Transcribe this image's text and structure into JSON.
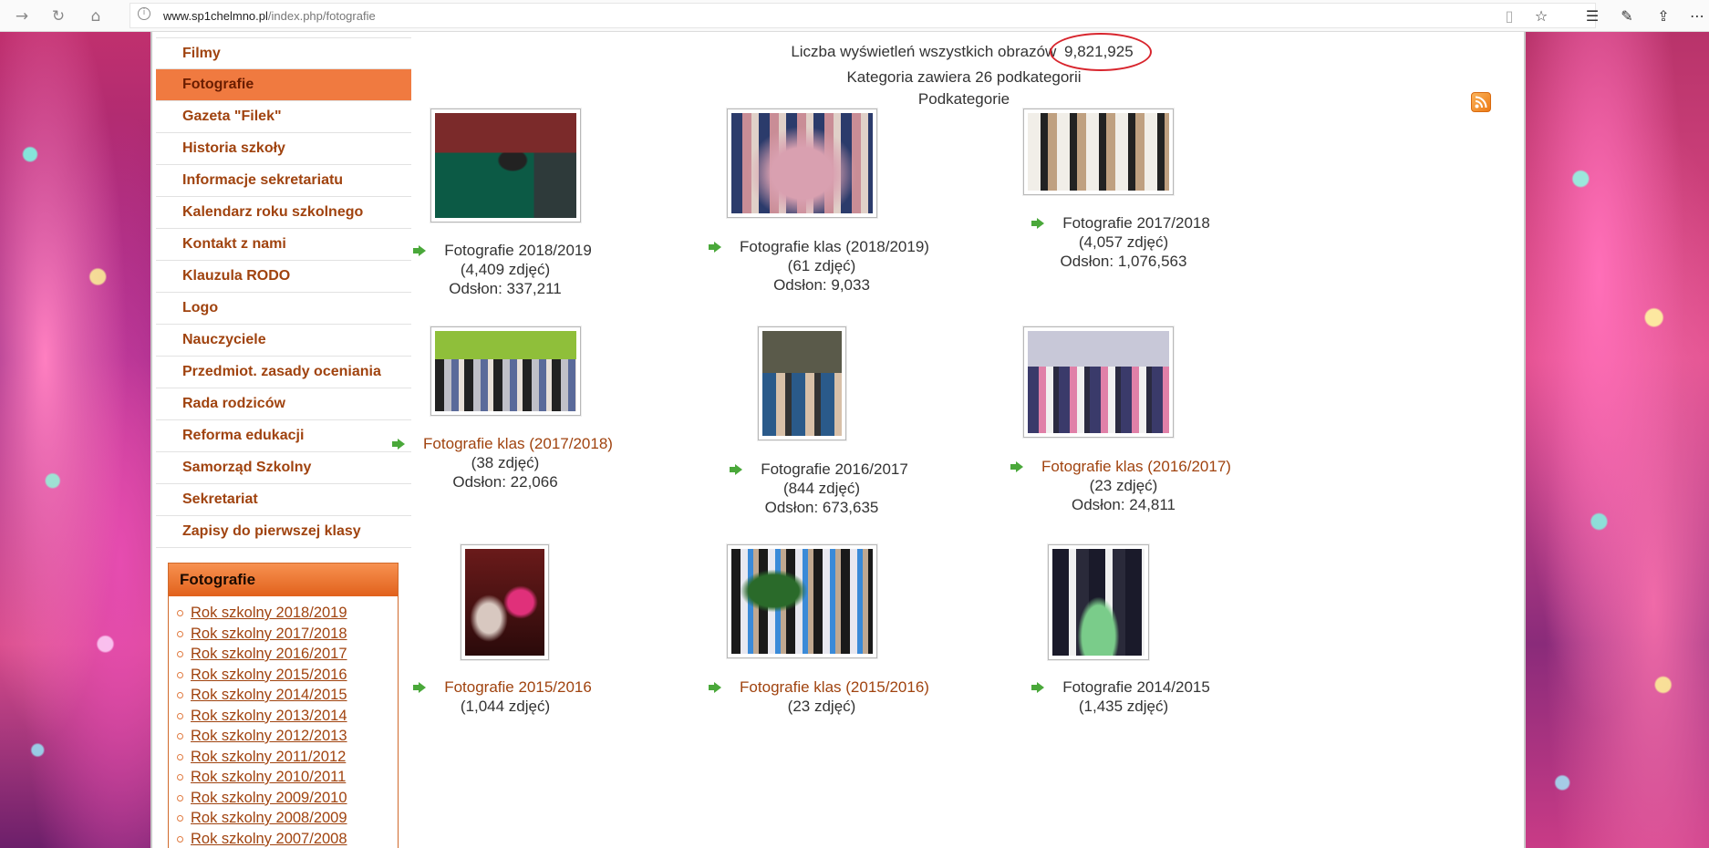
{
  "browser": {
    "url_host": "www.sp1chelmno.pl",
    "url_path": "/index.php/fotografie"
  },
  "sidebar_menu": [
    {
      "label": "Filmy",
      "active": false
    },
    {
      "label": "Fotografie",
      "active": true
    },
    {
      "label": "Gazeta \"Filek\"",
      "active": false
    },
    {
      "label": "Historia szkoły",
      "active": false
    },
    {
      "label": "Informacje sekretariatu",
      "active": false
    },
    {
      "label": "Kalendarz roku szkolnego",
      "active": false
    },
    {
      "label": "Kontakt z nami",
      "active": false
    },
    {
      "label": "Klauzula RODO",
      "active": false
    },
    {
      "label": "Logo",
      "active": false
    },
    {
      "label": "Nauczyciele",
      "active": false
    },
    {
      "label": "Przedmiot. zasady oceniania",
      "active": false
    },
    {
      "label": "Rada rodziców",
      "active": false
    },
    {
      "label": "Reforma edukacji",
      "active": false
    },
    {
      "label": "Samorząd Szkolny",
      "active": false
    },
    {
      "label": "Sekretariat",
      "active": false
    },
    {
      "label": "Zapisy do pierwszej klasy",
      "active": false
    }
  ],
  "sidebox": {
    "title": "Fotografie",
    "items": [
      "Rok szkolny 2018/2019",
      "Rok szkolny 2017/2018",
      "Rok szkolny 2016/2017",
      "Rok szkolny 2015/2016",
      "Rok szkolny 2014/2015",
      "Rok szkolny 2013/2014",
      "Rok szkolny 2012/2013",
      "Rok szkolny 2011/2012",
      "Rok szkolny 2010/2011",
      "Rok szkolny 2009/2010",
      "Rok szkolny 2008/2009",
      "Rok szkolny 2007/2008"
    ]
  },
  "main": {
    "views_label": "Liczba wyświetleń wszystkich obrazów",
    "views_count": "9,821,925",
    "subcategory_count_text": "Kategoria zawiera 26 podkategorii",
    "subcategories_heading": "Podkategorie",
    "categories": [
      {
        "title": "Fotografie 2018/2019",
        "count": "(4,409 zdjęć)",
        "views": "Odsłon: 337,211",
        "link_color": false,
        "img": "stage"
      },
      {
        "title": "Fotografie klas (2018/2019)",
        "count": "(61 zdjęć)",
        "views": "Odsłon: 9,033",
        "link_color": false,
        "img": "class"
      },
      {
        "title": "Fotografie 2017/2018",
        "count": "(4,057 zdjęć)",
        "views": "Odsłon: 1,076,563",
        "link_color": false,
        "img": "hall"
      },
      {
        "title": "Fotografie klas (2017/2018)",
        "count": "(38 zdjęć)",
        "views": "Odsłon: 22,066",
        "link_color": true,
        "img": "green"
      },
      {
        "title": "Fotografie 2016/2017",
        "count": "(844 zdjęć)",
        "views": "Odsłon: 673,635",
        "link_color": false,
        "img": "small"
      },
      {
        "title": "Fotografie klas (2016/2017)",
        "count": "(23 zdjęć)",
        "views": "Odsłon: 24,811",
        "link_color": true,
        "img": "group"
      },
      {
        "title": "Fotografie 2015/2016",
        "count": "(1,044 zdjęć)",
        "views": "",
        "link_color": true,
        "img": "dark"
      },
      {
        "title": "Fotografie klas (2015/2016)",
        "count": "(23 zdjęć)",
        "views": "",
        "link_color": true,
        "img": "tree"
      },
      {
        "title": "Fotografie 2014/2015",
        "count": "(1,435 zdjęć)",
        "views": "",
        "link_color": false,
        "img": "girls"
      }
    ]
  }
}
